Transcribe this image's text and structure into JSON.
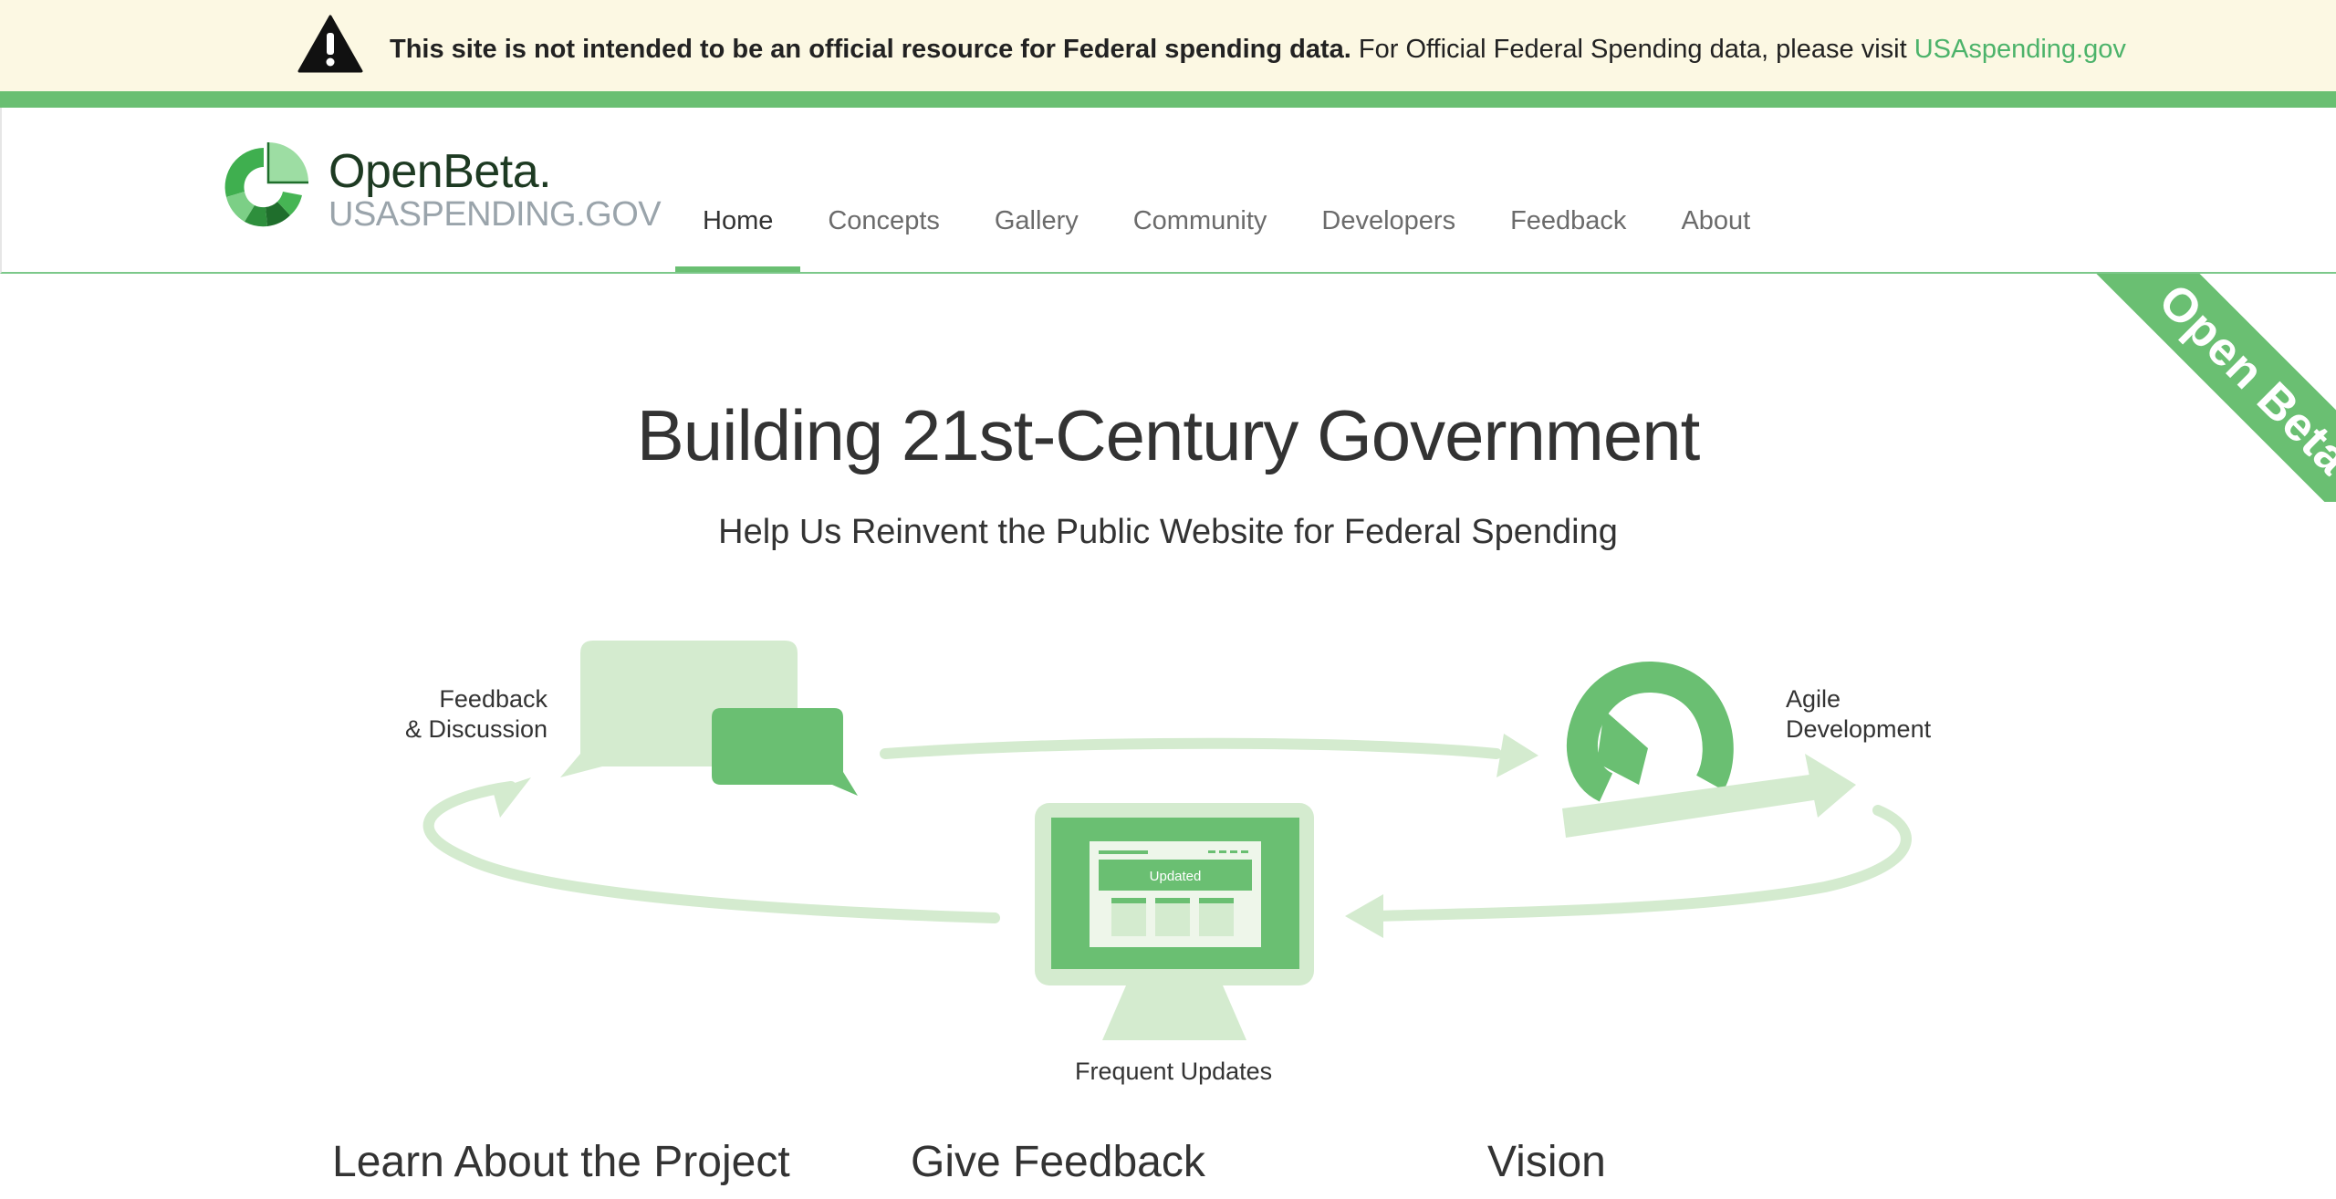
{
  "banner": {
    "bold_text": "This site is not intended to be an official resource for Federal spending data.",
    "text": " For Official Federal Spending data, please visit ",
    "link_text": "USAspending.gov"
  },
  "logo": {
    "name": "OpenBeta.",
    "sub": "USASPENDING.GOV"
  },
  "nav": {
    "items": [
      {
        "label": "Home",
        "active": true
      },
      {
        "label": "Concepts"
      },
      {
        "label": "Gallery"
      },
      {
        "label": "Community"
      },
      {
        "label": "Developers"
      },
      {
        "label": "Feedback"
      },
      {
        "label": "About"
      }
    ]
  },
  "ribbon": "Open Beta",
  "hero": {
    "title": "Building 21st-Century Government",
    "subtitle": "Help Us Reinvent the Public Website for Federal Spending"
  },
  "diagram": {
    "feedback_label_1": "Feedback",
    "feedback_label_2": "& Discussion",
    "agile_label_1": "Agile",
    "agile_label_2": "Development",
    "updates_label": "Frequent Updates",
    "screen_badge": "Updated"
  },
  "sections": {
    "learn": "Learn About the Project",
    "feedback": "Give Feedback",
    "vision": "Vision"
  },
  "colors": {
    "accent": "#6abf72",
    "light_accent": "#d4ebcf",
    "banner_bg": "#fcf8e3",
    "link": "#4cb36a"
  }
}
